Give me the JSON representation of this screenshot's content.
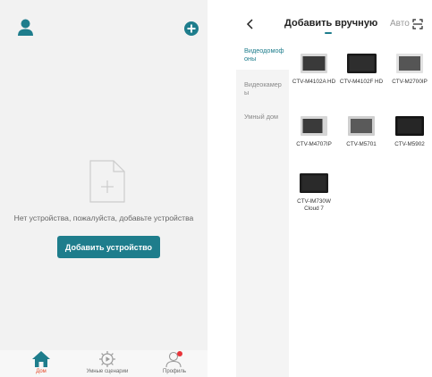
{
  "left_screen": {
    "empty_message": "Нет устройства, пожалуйста, добавьте устройства",
    "add_device_button": "Добавить устройство",
    "bottom_nav": {
      "items": [
        {
          "label": "Дом",
          "icon": "home-icon",
          "active": true
        },
        {
          "label": "Умные сценарии",
          "icon": "gear-icon",
          "active": false
        },
        {
          "label": "Профиль",
          "icon": "profile-icon",
          "active": false
        }
      ]
    }
  },
  "right_screen": {
    "header": {
      "title": "Добавить вручную",
      "auto_label": "Авто"
    },
    "categories": [
      {
        "label": "Видеодомофоны",
        "active": true
      },
      {
        "label": "Видеокамеры",
        "active": false
      },
      {
        "label": "Умный дом",
        "active": false
      }
    ],
    "devices": [
      {
        "name": "CTV-M4102A HD"
      },
      {
        "name": "CTV-M4102F HD"
      },
      {
        "name": "CTV-M2700IP"
      },
      {
        "name": "CTV-M4707IP"
      },
      {
        "name": "CTV-M5701"
      },
      {
        "name": "CTV-M5902"
      },
      {
        "name": "CTV-IM730W Cloud 7"
      }
    ]
  },
  "colors": {
    "accent": "#1e7d8c",
    "active_nav": "#e44d2e",
    "profile_dot": "#e8343a"
  }
}
